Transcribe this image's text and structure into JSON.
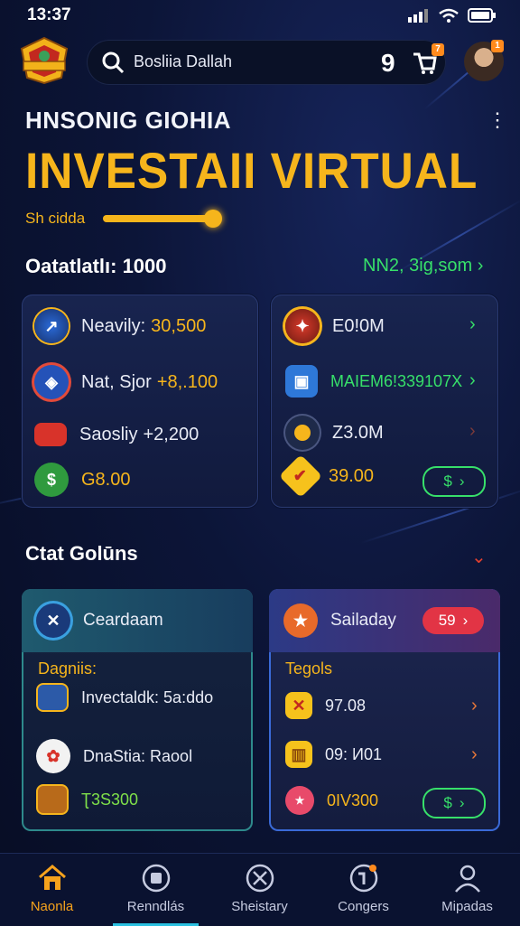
{
  "status": {
    "time": "13:37"
  },
  "header": {
    "search_text": "Bosliia Dallah",
    "cart_badge": "9",
    "notif_badge": "7",
    "avatar_badge": "1"
  },
  "hero": {
    "subtitle": "HNSONIG GIOHIA",
    "headline": "INVESTAII VIRTUAL",
    "progress_label": "Sh cidda",
    "progress_fraction": 0.95
  },
  "summary": {
    "title": "Oatatlatlı: 1000",
    "link": "NN2, 3ig,som"
  },
  "left_card": {
    "rows": [
      {
        "label": "Neavily:",
        "value": "30,500"
      },
      {
        "label": "Nat, Sjor",
        "value": "+8,.100"
      },
      {
        "label": "Saosliy",
        "value": "+2,200"
      },
      {
        "label": "",
        "value": "G8.00"
      }
    ]
  },
  "right_card": {
    "rows": [
      {
        "text": "E0!0M"
      },
      {
        "text": "MAIEM6!339107X"
      },
      {
        "text": "Z3.0M"
      },
      {
        "text": "39.00"
      }
    ],
    "pill": "$"
  },
  "section2": {
    "title": "Ctat Golūns"
  },
  "panel_left": {
    "head": "Ceardaam",
    "subhead": "Dagniis:",
    "rows": [
      {
        "text": "Invectaldk: 5a:ddo"
      },
      {
        "text": "DnaStia: Raool"
      },
      {
        "text": "Ʈ3S300"
      }
    ]
  },
  "panel_right": {
    "head": "Sailaday",
    "badge": "59",
    "subhead": "Tegols",
    "rows": [
      {
        "text": "97.08"
      },
      {
        "text": "09: И01"
      },
      {
        "text": "0IV300"
      }
    ],
    "pill": "$"
  },
  "nav": {
    "items": [
      {
        "label": "Naonla",
        "active": true
      },
      {
        "label": "Renndlás",
        "active": false
      },
      {
        "label": "Sheistary",
        "active": false
      },
      {
        "label": "Congers",
        "active": false
      },
      {
        "label": "Mipadas",
        "active": false
      }
    ]
  },
  "colors": {
    "accent": "#f6b51c",
    "positive": "#37e06a",
    "bg": "#0c1538",
    "alert": "#e23445"
  }
}
